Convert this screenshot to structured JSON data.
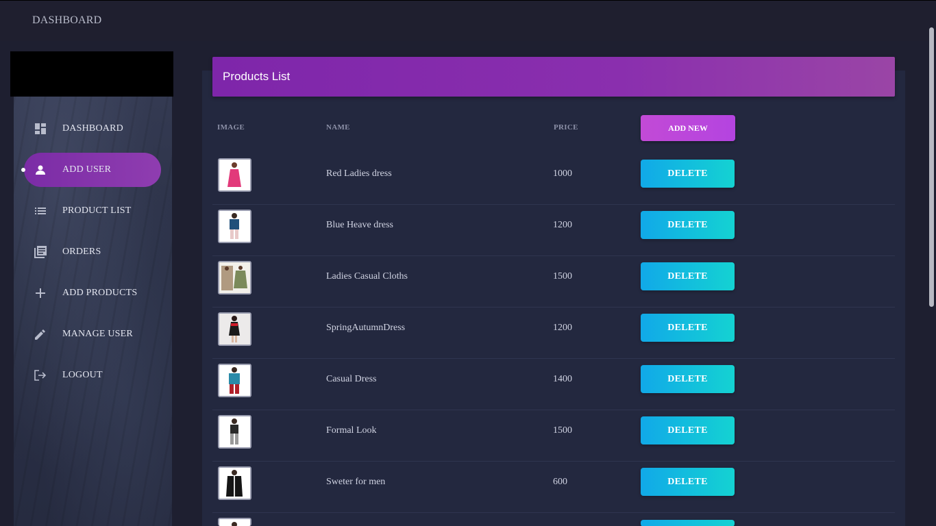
{
  "topbar": {
    "title": "DASHBOARD"
  },
  "sidebar": {
    "items": [
      {
        "label": "DASHBOARD",
        "icon": "dashboard-icon"
      },
      {
        "label": "ADD USER",
        "icon": "person-icon",
        "active": true
      },
      {
        "label": "PRODUCT LIST",
        "icon": "list-icon"
      },
      {
        "label": "ORDERS",
        "icon": "orders-icon"
      },
      {
        "label": "ADD PRODUCTS",
        "icon": "plus-icon"
      },
      {
        "label": "MANAGE USER",
        "icon": "pencil-icon"
      },
      {
        "label": "LOGOUT",
        "icon": "logout-icon"
      }
    ]
  },
  "panel": {
    "title": "Products List",
    "columns": {
      "image": "IMAGE",
      "name": "NAME",
      "price": "PRICE"
    },
    "add_label": "ADD NEW",
    "delete_label": "DELETE",
    "rows": [
      {
        "name": "Red Ladies dress",
        "price": "1000"
      },
      {
        "name": "Blue Heave dress",
        "price": "1200"
      },
      {
        "name": "Ladies Casual Cloths",
        "price": "1500"
      },
      {
        "name": "SpringAutumnDress",
        "price": "1200"
      },
      {
        "name": "Casual Dress",
        "price": "1400"
      },
      {
        "name": "Formal Look",
        "price": "1500"
      },
      {
        "name": "Sweter for men",
        "price": "600"
      }
    ]
  },
  "colors": {
    "accent_purple": "#7e26aa",
    "delete_start": "#11a9e8",
    "delete_end": "#14d2d2",
    "add_button": "#c24ad6"
  }
}
